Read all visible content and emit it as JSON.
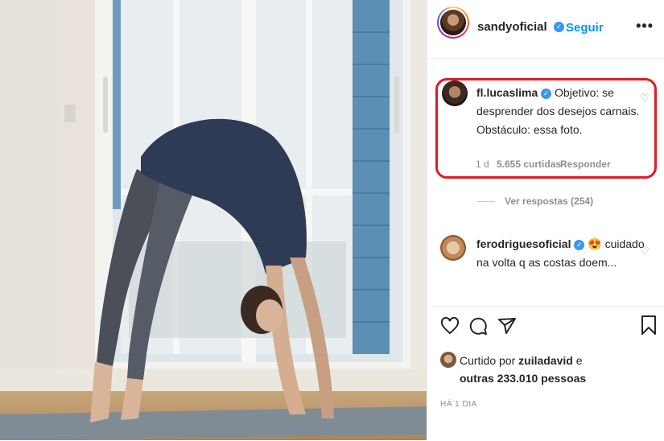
{
  "post": {
    "author": "sandyoficial",
    "follow_label": "Seguir",
    "separator": "•",
    "more_label": "•••",
    "verified_mark": "✓"
  },
  "comments": [
    {
      "username": "fl.lucaslima",
      "text_line1": "Objetivo: se",
      "text_line2": "desprender dos desejos carnais.",
      "text_line3": "Obstáculo: essa foto.",
      "age": "1 d",
      "likes": "5.655 curtidas",
      "reply_label": "Responder",
      "view_replies": "Ver respostas (254)"
    },
    {
      "username": "ferodriguesoficial",
      "emoji": "😍",
      "text_line1": "cuidado",
      "text_line2": "na volta q as costas doem..."
    }
  ],
  "likes": {
    "prefix": "Curtido por ",
    "user": "zuiladavid",
    "suffix": " e",
    "others": "outras 233.010 pessoas"
  },
  "timestamp": "HÁ 1 DIA",
  "icons": [
    "heart-icon",
    "comment-icon",
    "share-icon",
    "bookmark-icon"
  ],
  "colors": {
    "link": "#0095f6",
    "verified": "#3897f0",
    "highlight": "#e01b24"
  }
}
